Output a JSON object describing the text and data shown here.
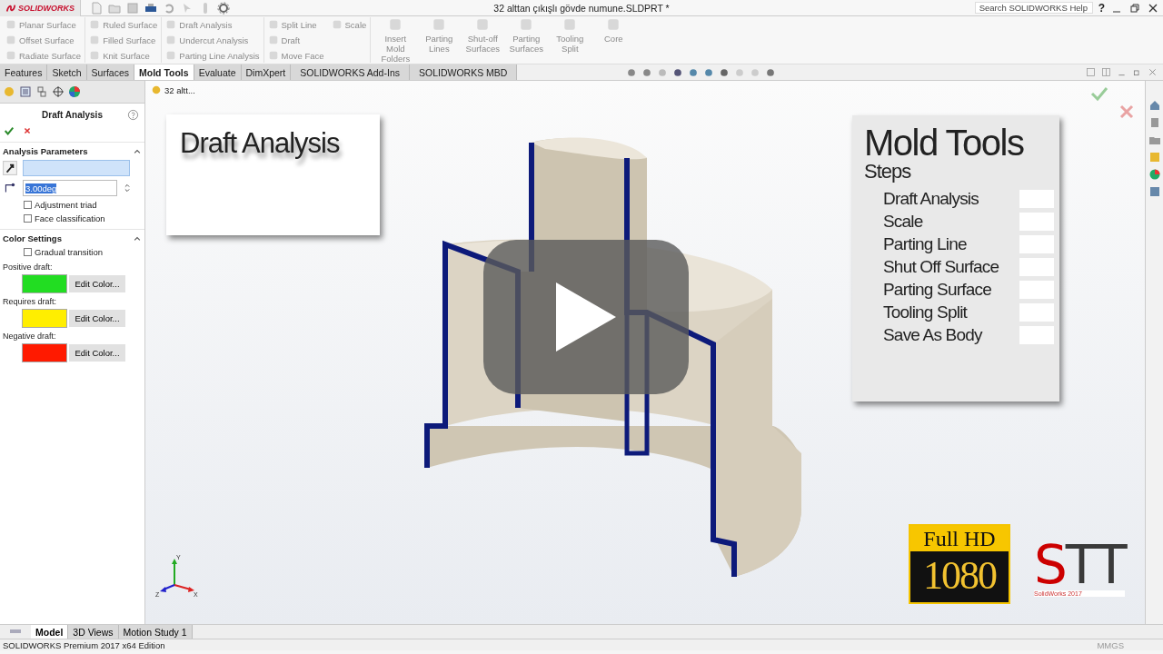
{
  "app": {
    "logo": "SOLIDWORKS"
  },
  "window": {
    "title": "32 alttan çıkışlı gövde numune.SLDPRT *"
  },
  "search": {
    "placeholder": "Search SOLIDWORKS Help"
  },
  "help_menu": "?",
  "ribbon": {
    "groups": [
      {
        "items": [
          {
            "label": "Planar Surface",
            "disabled": true
          },
          {
            "label": "Offset Surface",
            "disabled": true
          },
          {
            "label": "Radiate Surface",
            "disabled": true
          }
        ]
      },
      {
        "items": [
          {
            "label": "Ruled Surface",
            "disabled": true
          },
          {
            "label": "Filled Surface",
            "disabled": true
          },
          {
            "label": "Knit Surface",
            "disabled": true
          }
        ]
      },
      {
        "items": [
          {
            "label": "Draft Analysis",
            "disabled": true
          },
          {
            "label": "Undercut Analysis",
            "disabled": true
          },
          {
            "label": "Parting Line Analysis",
            "disabled": true
          }
        ]
      },
      {
        "items": [
          {
            "label": "Split Line",
            "disabled": true
          },
          {
            "label": "Draft",
            "disabled": true
          },
          {
            "label": "Move Face",
            "disabled": true
          }
        ]
      },
      {
        "items": [
          {
            "label": "Scale",
            "disabled": true
          }
        ]
      }
    ],
    "large_buttons": [
      {
        "label": "Insert Mold Folders",
        "disabled": true
      },
      {
        "label": "Parting Lines",
        "disabled": true
      },
      {
        "label": "Shut-off Surfaces",
        "disabled": true
      },
      {
        "label": "Parting Surfaces",
        "disabled": true
      },
      {
        "label": "Tooling Split",
        "disabled": true
      },
      {
        "label": "Core",
        "disabled": true
      }
    ]
  },
  "tabs": [
    {
      "label": "Features",
      "selected": false
    },
    {
      "label": "Sketch",
      "selected": false
    },
    {
      "label": "Surfaces",
      "selected": false
    },
    {
      "label": "Mold Tools",
      "selected": true
    },
    {
      "label": "Evaluate",
      "selected": false
    },
    {
      "label": "DimXpert",
      "selected": false
    },
    {
      "label": "SOLIDWORKS Add-Ins",
      "selected": false
    },
    {
      "label": "SOLIDWORKS MBD",
      "selected": false
    }
  ],
  "panel": {
    "title": "Draft Analysis",
    "analysis_parameters": {
      "title": "Analysis Parameters",
      "expanded": true,
      "angle": "3.00deg",
      "options": [
        {
          "label": "Adjustment triad",
          "checked": false
        },
        {
          "label": "Face classification",
          "checked": false
        }
      ]
    },
    "color_settings": {
      "title": "Color Settings",
      "expanded": true,
      "options": [
        {
          "label": "Gradual transition",
          "checked": false
        }
      ],
      "colors": [
        {
          "label": "Positive draft:",
          "color": "#22dd22",
          "button": "Edit Color..."
        },
        {
          "label": "Requires draft:",
          "color": "#ffee00",
          "button": "Edit Color..."
        },
        {
          "label": "Negative draft:",
          "color": "#ff1a00",
          "button": "Edit Color..."
        }
      ]
    }
  },
  "viewport": {
    "breadcrumb": "32 altt...",
    "overlay_title": "Draft Analysis",
    "steps_card": {
      "title": "Mold Tools",
      "subtitle": "Steps",
      "steps": [
        {
          "label": "Draft Analysis",
          "checked": false
        },
        {
          "label": "Scale",
          "checked": false
        },
        {
          "label": "Parting Line",
          "checked": false
        },
        {
          "label": "Shut Off Surface",
          "checked": false
        },
        {
          "label": "Parting Surface",
          "checked": false
        },
        {
          "label": "Tooling Split",
          "checked": false
        },
        {
          "label": "Save  As Body",
          "checked": false
        }
      ]
    },
    "badge": {
      "line1": "Full HD",
      "line2": "1080"
    },
    "brand": {
      "text": "STT",
      "caption": "SolidWorks 2017"
    },
    "triad": {
      "x": "X",
      "y": "Y",
      "z": "Z"
    }
  },
  "bottom_tabs": [
    {
      "label": "Model",
      "selected": true
    },
    {
      "label": "3D Views",
      "selected": false
    },
    {
      "label": "Motion Study 1",
      "selected": false
    }
  ],
  "status_bar": {
    "edition": "SOLIDWORKS Premium 2017 x64 Edition",
    "units": "MMGS"
  }
}
